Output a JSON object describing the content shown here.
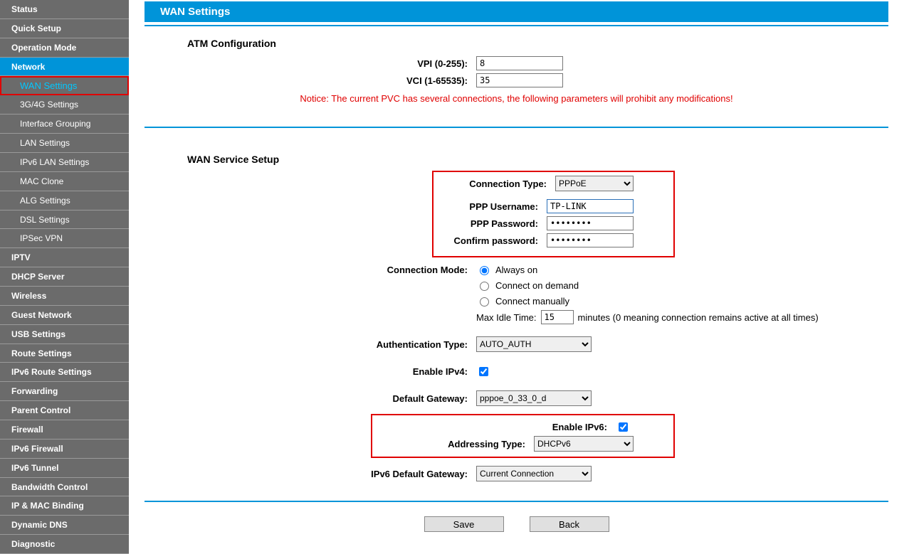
{
  "page_title": "WAN Settings",
  "sidebar": [
    {
      "kind": "top",
      "label": "Status"
    },
    {
      "kind": "top",
      "label": "Quick Setup"
    },
    {
      "kind": "top",
      "label": "Operation Mode"
    },
    {
      "kind": "top",
      "label": "Network",
      "sel": true
    },
    {
      "kind": "subsel",
      "label": "WAN Settings"
    },
    {
      "kind": "sub",
      "label": "3G/4G Settings"
    },
    {
      "kind": "sub",
      "label": "Interface Grouping"
    },
    {
      "kind": "sub",
      "label": "LAN Settings"
    },
    {
      "kind": "sub",
      "label": "IPv6 LAN Settings"
    },
    {
      "kind": "sub",
      "label": "MAC Clone"
    },
    {
      "kind": "sub",
      "label": "ALG Settings"
    },
    {
      "kind": "sub",
      "label": "DSL Settings"
    },
    {
      "kind": "sub",
      "label": "IPSec VPN"
    },
    {
      "kind": "top",
      "label": "IPTV"
    },
    {
      "kind": "top",
      "label": "DHCP Server"
    },
    {
      "kind": "top",
      "label": "Wireless"
    },
    {
      "kind": "top",
      "label": "Guest Network"
    },
    {
      "kind": "top",
      "label": "USB Settings"
    },
    {
      "kind": "top",
      "label": "Route Settings"
    },
    {
      "kind": "top",
      "label": "IPv6 Route Settings"
    },
    {
      "kind": "top",
      "label": "Forwarding"
    },
    {
      "kind": "top",
      "label": "Parent Control"
    },
    {
      "kind": "top",
      "label": "Firewall"
    },
    {
      "kind": "top",
      "label": "IPv6 Firewall"
    },
    {
      "kind": "top",
      "label": "IPv6 Tunnel"
    },
    {
      "kind": "top",
      "label": "Bandwidth Control"
    },
    {
      "kind": "top",
      "label": "IP & MAC Binding"
    },
    {
      "kind": "top",
      "label": "Dynamic DNS"
    },
    {
      "kind": "top",
      "label": "Diagnostic"
    }
  ],
  "atm": {
    "title": "ATM Configuration",
    "vpi_label": "VPI (0-255):",
    "vpi_value": "8",
    "vci_label": "VCI (1-65535):",
    "vci_value": "35",
    "notice": "Notice: The current PVC has several connections, the following parameters will prohibit any modifications!"
  },
  "wan": {
    "title": "WAN Service Setup",
    "conn_type_label": "Connection Type:",
    "conn_type_value": "PPPoE",
    "ppp_user_label": "PPP Username:",
    "ppp_user_value": "TP-LINK",
    "ppp_pass_label": "PPP Password:",
    "ppp_pass_value": "••••••••",
    "ppp_conf_label": "Confirm password:",
    "ppp_conf_value": "••••••••",
    "conn_mode_label": "Connection Mode:",
    "mode_always": "Always on",
    "mode_demand": "Connect on demand",
    "mode_manual": "Connect manually",
    "max_idle_label": "Max Idle Time:",
    "max_idle_value": "15",
    "max_idle_after": "minutes (0 meaning connection remains active at all times)",
    "auth_label": "Authentication Type:",
    "auth_value": "AUTO_AUTH",
    "enable_ipv4_label": "Enable IPv4:",
    "def_gw_label": "Default Gateway:",
    "def_gw_value": "pppoe_0_33_0_d",
    "enable_ipv6_label": "Enable IPv6:",
    "addr_type_label": "Addressing Type:",
    "addr_type_value": "DHCPv6",
    "ipv6_gw_label": "IPv6 Default Gateway:",
    "ipv6_gw_value": "Current Connection"
  },
  "buttons": {
    "save": "Save",
    "back": "Back"
  }
}
